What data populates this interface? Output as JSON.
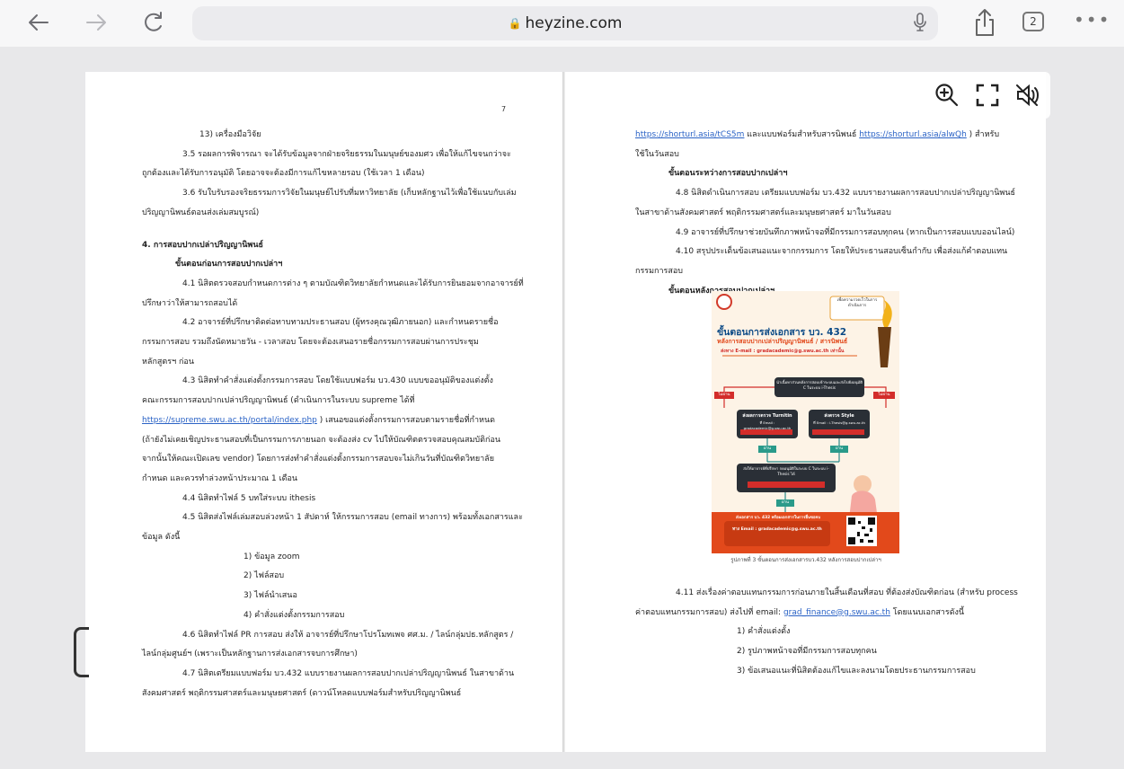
{
  "browser": {
    "url": "heyzine.com",
    "tab_count": "2",
    "more_label": "•••"
  },
  "toolbar": {
    "zoom_icon": "zoom-in-icon",
    "fullscreen_icon": "fullscreen-icon",
    "mute_icon": "speaker-muted-icon"
  },
  "left_page": {
    "page_number": "7",
    "lines": [
      {
        "t": "13) เครื่องมือวิจัย",
        "c": "ind3"
      },
      {
        "t": "3.5 รอผลการพิจารณา จะได้รับข้อมูลจากฝ่ายจริยธรรมในมนุษย์ของมศว เพื่อให้แก้ไขจนกว่าจะ",
        "c": "ind1"
      },
      {
        "t": "ถูกต้องและได้รับการอนุมัติ โดยอาจจะต้องมีการแก้ไขหลายรอบ (ใช้เวลา 1 เดือน)",
        "c": ""
      },
      {
        "t": "3.6 รับใบรับรองจริยธรรมการวิจัยในมนุษย์ไปรับที่มหาวิทยาลัย (เก็บหลักฐานไว้เพื่อใช้แนบกับเล่ม",
        "c": "ind1"
      },
      {
        "t": "ปริญญานิพนธ์ตอนส่งเล่มสมบูรณ์)",
        "c": ""
      },
      {
        "t": "",
        "c": "gap"
      },
      {
        "t": "4. การสอบปากเปล่าปริญญานิพนธ์",
        "c": "b"
      },
      {
        "t": "ขั้นตอนก่อนการสอบปากเปล่าฯ",
        "c": "ind2 b"
      },
      {
        "t": "4.1 นิสิตตรวจสอบกำหนดการต่าง ๆ ตามบัณฑิตวิทยาลัยกำหนดและได้รับการยินยอมจากอาจารย์ที่",
        "c": "ind1"
      },
      {
        "t": "ปรึกษาว่าให้สามารถสอบได้",
        "c": ""
      },
      {
        "t": "4.2 อาจารย์ที่ปรึกษาติดต่อทาบทามประธานสอบ (ผู้ทรงคุณวุฒิภายนอก) และกำหนดรายชื่อ",
        "c": "ind1"
      },
      {
        "t": "กรรมการสอบ รวมถึงนัดหมายวัน - เวลาสอบ โดยจะต้องเสนอรายชื่อกรรมการสอบผ่านการประชุม",
        "c": ""
      },
      {
        "t": "หลักสูตรฯ ก่อน",
        "c": ""
      },
      {
        "t": "4.3 นิสิตทำคำสั่งแต่งตั้งกรรมการสอบ โดยใช้แบบฟอร์ม บว.430 แบบขออนุมัติของแต่งตั้ง",
        "c": "ind1"
      },
      {
        "t": "คณะกรรมการสอบปากเปล่าปริญญานิพนธ์ (ดำเนินการในระบบ supreme ได้ที่",
        "c": ""
      },
      {
        "t": "https://supreme.swu.ac.th/portal/index.php",
        "c": "link",
        "tail": " ) เสนอขอแต่งตั้งกรรมการสอบตามรายชื่อที่กำหนด"
      },
      {
        "t": "(ถ้ายังไม่เคยเชิญประธานสอบที่เป็นกรรมการภายนอก จะต้องส่ง cv ไปให้บัณฑิตตรวจสอบคุณสมบัติก่อน",
        "c": ""
      },
      {
        "t": "จากนั้นให้คณะเปิดเลข vendor) โดยการส่งทำคำสั่งแต่งตั้งกรรมการสอบจะไม่เกินวันที่บัณฑิตวิทยาลัย",
        "c": ""
      },
      {
        "t": "กำหนด และควรทำล่วงหน้าประมาณ 1 เดือน",
        "c": ""
      },
      {
        "t": "4.4  นิสิตทำไฟล์ 5 บทใส่ระบบ ithesis",
        "c": "ind1"
      },
      {
        "t": "4.5 นิสิตส่งไฟล์เล่มสอบล่วงหน้า 1 สัปดาห์ ให้กรรมการสอบ (email ทางการ) พร้อมทั้งเอกสารและ",
        "c": "ind1"
      },
      {
        "t": "ข้อมูล ดังนี้",
        "c": ""
      },
      {
        "t": "1) ข้อมูล zoom",
        "c": "ind4"
      },
      {
        "t": "2) ไฟล์สอบ",
        "c": "ind4"
      },
      {
        "t": "3) ไฟล์นำเสนอ",
        "c": "ind4"
      },
      {
        "t": "4) คำสั่งแต่งตั้งกรรมการสอบ",
        "c": "ind4"
      },
      {
        "t": "4.6 นิสิตทำไฟล์ PR การสอบ ส่งให้ อาจารย์ที่ปรึกษาโปรโมทเพจ ศศ.ม. / ไลน์กลุ่มปธ.หลักสูตร /",
        "c": "ind1"
      },
      {
        "t": "ไลน์กลุ่มศูนย์ฯ (เพราะเป็นหลักฐานการส่งเอกสารจบการศึกษา)",
        "c": ""
      },
      {
        "t": "4.7 นิสิตเตรียมแบบฟอร์ม บว.432 แบบรายงานผลการสอบปากเปล่าปริญญานิพนธ์ ในสาขาด้าน",
        "c": "ind1"
      },
      {
        "t": "สังคมศาสตร์ พฤติกรรมศาสตร์และมนุษยศาสตร์ (ดาวน์โหลดแบบฟอร์มสำหรับปริญญานิพนธ์",
        "c": ""
      }
    ]
  },
  "right_page": {
    "top_lines": [
      {
        "t": "https://shorturl.asia/tCS5m",
        "c": "link",
        "tail": "  และแบบฟอร์มสำหรับสารนิพนธ์ ",
        "t2": "https://shorturl.asia/alwQh",
        "tail2": " ) สำหรับ"
      },
      {
        "t": "ใช้ในวันสอบ",
        "c": ""
      },
      {
        "t": "ขั้นตอนระหว่างการสอบปากเปล่าฯ",
        "c": "ind2 b"
      },
      {
        "t": "4.8 นิสิตดำเนินการสอบ เตรียมแบบฟอร์ม บว.432 แบบรายงานผลการสอบปากเปล่าปริญญานิพนธ์",
        "c": "ind1"
      },
      {
        "t": "ในสาขาด้านสังคมศาสตร์ พฤติกรรมศาสตร์และมนุษยศาสตร์ มาในวันสอบ",
        "c": ""
      },
      {
        "t": "4.9 อาจารย์ที่ปรึกษาช่วยบันทึกภาพหน้าจอที่มีกรรมการสอบทุกคน (หากเป็นการสอบแบบออนไลน์)",
        "c": "ind1"
      },
      {
        "t": "4.10 สรุปประเด็นข้อเสนอแนะจากกรรมการ โดยให้ประธานสอบเซ็นกำกับ เพื่อส่งแก้คำตอบแทน",
        "c": "ind1"
      },
      {
        "t": "กรรมการสอบ",
        "c": ""
      },
      {
        "t": "ขั้นตอนหลังการสอบปากเปล่าฯ",
        "c": "ind2 b"
      }
    ],
    "figure": {
      "title_line1": "ขั้นตอนการส่งเอกสาร บว. 432",
      "title_line2": "หลังการสอบปากเปล่าปริญญานิพนธ์ / สารนิพนธ์",
      "email_line": "ส่งทาง E-mail : gradacademic@g.swu.ac.th เท่านั้น",
      "corner_note": "เพื่อความรวดเร็วในการดำเนินการ",
      "step1": "นำเนื้อหาส่วนหลังการสอบเข้าระบบและส่งไปยังอนุมัติ C ในระบบ i-Thesis",
      "left_label": "ไม่ผ่าน",
      "right_label": "ไม่ผ่าน",
      "box_left_title": "ส่งผลการตรวจ Turnitin",
      "box_left_sub": "ที่ Email : gradacademic@g.swu.ac.th",
      "box_right_title": "ส่งตรวจ Style",
      "box_right_sub": "ที่ Email : i-Thesis@g.swu.ac.th",
      "pass1": "ผ่าน",
      "pass2": "ผ่าน",
      "step3": "ส่งให้อาจารย์ที่ปรึกษา กดอนุมัติในระบบ C ในระบบ i-Thesis ได้",
      "pass3": "ผ่าน",
      "final_title": "ส่งเอกสาร บว. 432 พร้อมเอกสารในการยื่นขอจบ",
      "final_email": "ทาง Email : gradacademic@g.swu.ac.th",
      "caption": "รูปภาพที่ 3 ขั้นตอนการส่งเอกสารบว.432 หลังการสอบปากเปล่าฯ"
    },
    "bottom_lines": [
      {
        "t": "4.11 ส่งเรื่องค่าตอบแทนกรรมการก่อนภายในสิ้นเดือนที่สอบ ที่ต้องส่งบัณฑิตก่อน (สำหรับ process",
        "c": "ind1"
      },
      {
        "t": "ค่าตอบแทนกรรมการสอบ) ส่งไปที่ email: ",
        "c": "",
        "link": "grad_finance@g.swu.ac.th",
        "tail": " โดยแนบเอกสารดังนี้"
      },
      {
        "t": "1) คำสั่งแต่งตั้ง",
        "c": "ind4"
      },
      {
        "t": "2) รูปภาพหน้าจอที่มีกรรมการสอบทุกคน",
        "c": "ind4"
      },
      {
        "t": "3) ข้อเสนอแนะที่นิสิตต้องแก้ไขและลงนามโดยประธานกรรมการสอบ",
        "c": "ind4"
      }
    ]
  }
}
